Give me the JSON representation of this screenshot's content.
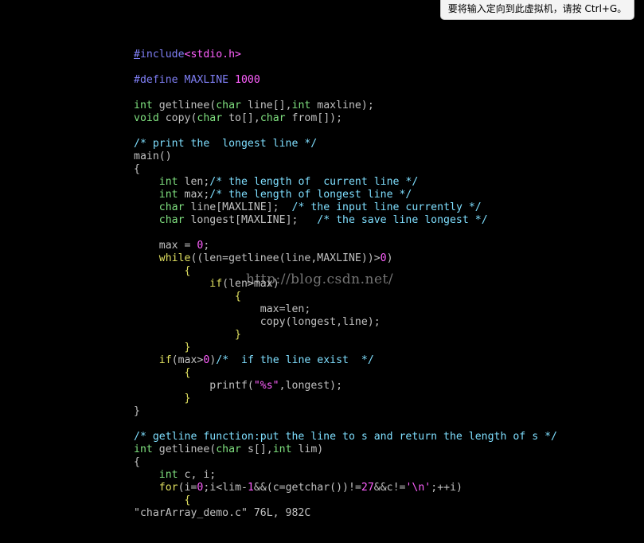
{
  "vm_tip": {
    "text": "要将输入定向到此虚拟机，请按 Ctrl+G。"
  },
  "editor": {
    "lines": [
      [
        [
          "pre-ul",
          "#"
        ],
        [
          "pre",
          "include"
        ],
        [
          "num",
          "<stdio.h>"
        ]
      ],
      [],
      [
        [
          "pre",
          "#define MAXLINE "
        ],
        [
          "num",
          "1000"
        ]
      ],
      [],
      [
        [
          "type",
          "int"
        ],
        [
          "plain",
          " getlinee("
        ],
        [
          "type",
          "char"
        ],
        [
          "plain",
          " line[],"
        ],
        [
          "type",
          "int"
        ],
        [
          "plain",
          " maxline);"
        ]
      ],
      [
        [
          "type",
          "void"
        ],
        [
          "plain",
          " copy("
        ],
        [
          "type",
          "char"
        ],
        [
          "plain",
          " to[],"
        ],
        [
          "type",
          "char"
        ],
        [
          "plain",
          " from[]);"
        ]
      ],
      [],
      [
        [
          "comment",
          "/* print the  longest line */"
        ]
      ],
      [
        [
          "plain",
          "main()"
        ]
      ],
      [
        [
          "plain",
          "{"
        ]
      ],
      [
        [
          "plain",
          "    "
        ],
        [
          "type",
          "int"
        ],
        [
          "plain",
          " len;"
        ],
        [
          "comment",
          "/* the length of  current line */"
        ]
      ],
      [
        [
          "plain",
          "    "
        ],
        [
          "type",
          "int"
        ],
        [
          "plain",
          " max;"
        ],
        [
          "comment",
          "/* the length of longest line */"
        ]
      ],
      [
        [
          "plain",
          "    "
        ],
        [
          "type",
          "char"
        ],
        [
          "plain",
          " line[MAXLINE];  "
        ],
        [
          "comment",
          "/* the input line currently */"
        ]
      ],
      [
        [
          "plain",
          "    "
        ],
        [
          "type",
          "char"
        ],
        [
          "plain",
          " longest[MAXLINE];   "
        ],
        [
          "comment",
          "/* the save line longest */"
        ]
      ],
      [],
      [
        [
          "plain",
          "    max = "
        ],
        [
          "num",
          "0"
        ],
        [
          "plain",
          ";"
        ]
      ],
      [
        [
          "plain",
          "    "
        ],
        [
          "kw",
          "while"
        ],
        [
          "plain",
          "((len=getlinee(line,MAXLINE))>"
        ],
        [
          "num",
          "0"
        ],
        [
          "plain",
          ")"
        ]
      ],
      [
        [
          "plain",
          "        "
        ],
        [
          "brace",
          "{"
        ]
      ],
      [
        [
          "plain",
          "            "
        ],
        [
          "kw",
          "if"
        ],
        [
          "plain",
          "(len>max)"
        ]
      ],
      [
        [
          "plain",
          "                "
        ],
        [
          "brace",
          "{"
        ]
      ],
      [
        [
          "plain",
          "                    max=len;"
        ]
      ],
      [
        [
          "plain",
          "                    copy(longest,line);"
        ]
      ],
      [
        [
          "plain",
          "                "
        ],
        [
          "brace",
          "}"
        ]
      ],
      [
        [
          "plain",
          "        "
        ],
        [
          "brace",
          "}"
        ]
      ],
      [
        [
          "plain",
          "    "
        ],
        [
          "kw",
          "if"
        ],
        [
          "plain",
          "(max>"
        ],
        [
          "num",
          "0"
        ],
        [
          "plain",
          ")"
        ],
        [
          "comment",
          "/*  if the line exist  */"
        ]
      ],
      [
        [
          "plain",
          "        "
        ],
        [
          "brace",
          "{"
        ]
      ],
      [
        [
          "plain",
          "            printf("
        ],
        [
          "str",
          "\"%s\""
        ],
        [
          "plain",
          ",longest);"
        ]
      ],
      [
        [
          "plain",
          "        "
        ],
        [
          "brace",
          "}"
        ]
      ],
      [
        [
          "plain",
          "}"
        ]
      ],
      [],
      [
        [
          "comment",
          "/* getline function:put the line to s and return the length of s */"
        ]
      ],
      [
        [
          "type",
          "int"
        ],
        [
          "plain",
          " getlinee("
        ],
        [
          "type",
          "char"
        ],
        [
          "plain",
          " s[],"
        ],
        [
          "type",
          "int"
        ],
        [
          "plain",
          " lim)"
        ]
      ],
      [
        [
          "plain",
          "{"
        ]
      ],
      [
        [
          "plain",
          "    "
        ],
        [
          "type",
          "int"
        ],
        [
          "plain",
          " c, i;"
        ]
      ],
      [
        [
          "plain",
          "    "
        ],
        [
          "kw",
          "for"
        ],
        [
          "plain",
          "(i="
        ],
        [
          "num",
          "0"
        ],
        [
          "plain",
          ";i<lim-"
        ],
        [
          "num",
          "1"
        ],
        [
          "plain",
          "&&(c=getchar())!="
        ],
        [
          "num",
          "27"
        ],
        [
          "plain",
          "&&c!="
        ],
        [
          "str",
          "'\\n'"
        ],
        [
          "plain",
          ";++i)"
        ]
      ],
      [
        [
          "plain",
          "        "
        ],
        [
          "brace",
          "{"
        ]
      ]
    ]
  },
  "status_line": {
    "text": "\"charArray_demo.c\" 76L, 982C"
  },
  "watermark": {
    "text": "http://blog.csdn.net/"
  },
  "colors": {
    "background": "#000000",
    "plain": "#c0c0c0",
    "preprocessor": "#7f7ff5",
    "type": "#7fe07f",
    "keyword": "#e0e060",
    "constant": "#ff60ff",
    "comment": "#7fdfff"
  }
}
